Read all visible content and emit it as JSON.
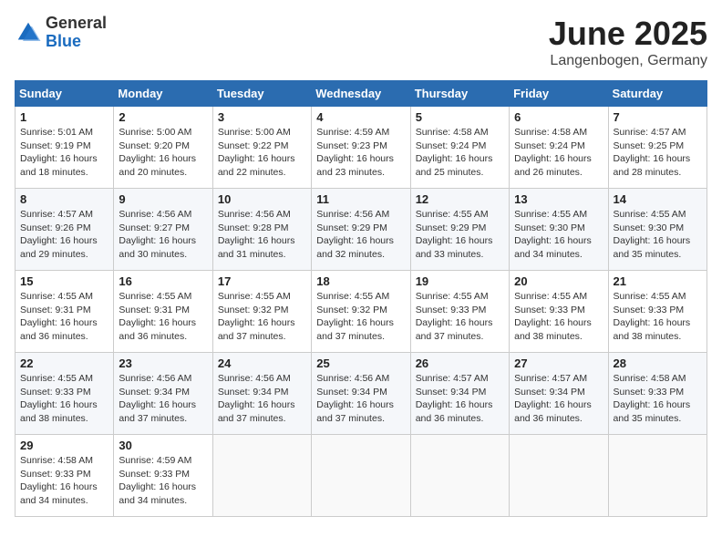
{
  "header": {
    "logo_general": "General",
    "logo_blue": "Blue",
    "title": "June 2025",
    "location": "Langenbogen, Germany"
  },
  "calendar": {
    "days_of_week": [
      "Sunday",
      "Monday",
      "Tuesday",
      "Wednesday",
      "Thursday",
      "Friday",
      "Saturday"
    ],
    "weeks": [
      [
        {
          "day": 1,
          "sunrise": "5:01 AM",
          "sunset": "9:19 PM",
          "daylight": "16 hours and 18 minutes."
        },
        {
          "day": 2,
          "sunrise": "5:00 AM",
          "sunset": "9:20 PM",
          "daylight": "16 hours and 20 minutes."
        },
        {
          "day": 3,
          "sunrise": "5:00 AM",
          "sunset": "9:22 PM",
          "daylight": "16 hours and 22 minutes."
        },
        {
          "day": 4,
          "sunrise": "4:59 AM",
          "sunset": "9:23 PM",
          "daylight": "16 hours and 23 minutes."
        },
        {
          "day": 5,
          "sunrise": "4:58 AM",
          "sunset": "9:24 PM",
          "daylight": "16 hours and 25 minutes."
        },
        {
          "day": 6,
          "sunrise": "4:58 AM",
          "sunset": "9:24 PM",
          "daylight": "16 hours and 26 minutes."
        },
        {
          "day": 7,
          "sunrise": "4:57 AM",
          "sunset": "9:25 PM",
          "daylight": "16 hours and 28 minutes."
        }
      ],
      [
        {
          "day": 8,
          "sunrise": "4:57 AM",
          "sunset": "9:26 PM",
          "daylight": "16 hours and 29 minutes."
        },
        {
          "day": 9,
          "sunrise": "4:56 AM",
          "sunset": "9:27 PM",
          "daylight": "16 hours and 30 minutes."
        },
        {
          "day": 10,
          "sunrise": "4:56 AM",
          "sunset": "9:28 PM",
          "daylight": "16 hours and 31 minutes."
        },
        {
          "day": 11,
          "sunrise": "4:56 AM",
          "sunset": "9:29 PM",
          "daylight": "16 hours and 32 minutes."
        },
        {
          "day": 12,
          "sunrise": "4:55 AM",
          "sunset": "9:29 PM",
          "daylight": "16 hours and 33 minutes."
        },
        {
          "day": 13,
          "sunrise": "4:55 AM",
          "sunset": "9:30 PM",
          "daylight": "16 hours and 34 minutes."
        },
        {
          "day": 14,
          "sunrise": "4:55 AM",
          "sunset": "9:30 PM",
          "daylight": "16 hours and 35 minutes."
        }
      ],
      [
        {
          "day": 15,
          "sunrise": "4:55 AM",
          "sunset": "9:31 PM",
          "daylight": "16 hours and 36 minutes."
        },
        {
          "day": 16,
          "sunrise": "4:55 AM",
          "sunset": "9:31 PM",
          "daylight": "16 hours and 36 minutes."
        },
        {
          "day": 17,
          "sunrise": "4:55 AM",
          "sunset": "9:32 PM",
          "daylight": "16 hours and 37 minutes."
        },
        {
          "day": 18,
          "sunrise": "4:55 AM",
          "sunset": "9:32 PM",
          "daylight": "16 hours and 37 minutes."
        },
        {
          "day": 19,
          "sunrise": "4:55 AM",
          "sunset": "9:33 PM",
          "daylight": "16 hours and 37 minutes."
        },
        {
          "day": 20,
          "sunrise": "4:55 AM",
          "sunset": "9:33 PM",
          "daylight": "16 hours and 38 minutes."
        },
        {
          "day": 21,
          "sunrise": "4:55 AM",
          "sunset": "9:33 PM",
          "daylight": "16 hours and 38 minutes."
        }
      ],
      [
        {
          "day": 22,
          "sunrise": "4:55 AM",
          "sunset": "9:33 PM",
          "daylight": "16 hours and 38 minutes."
        },
        {
          "day": 23,
          "sunrise": "4:56 AM",
          "sunset": "9:34 PM",
          "daylight": "16 hours and 37 minutes."
        },
        {
          "day": 24,
          "sunrise": "4:56 AM",
          "sunset": "9:34 PM",
          "daylight": "16 hours and 37 minutes."
        },
        {
          "day": 25,
          "sunrise": "4:56 AM",
          "sunset": "9:34 PM",
          "daylight": "16 hours and 37 minutes."
        },
        {
          "day": 26,
          "sunrise": "4:57 AM",
          "sunset": "9:34 PM",
          "daylight": "16 hours and 36 minutes."
        },
        {
          "day": 27,
          "sunrise": "4:57 AM",
          "sunset": "9:34 PM",
          "daylight": "16 hours and 36 minutes."
        },
        {
          "day": 28,
          "sunrise": "4:58 AM",
          "sunset": "9:33 PM",
          "daylight": "16 hours and 35 minutes."
        }
      ],
      [
        {
          "day": 29,
          "sunrise": "4:58 AM",
          "sunset": "9:33 PM",
          "daylight": "16 hours and 34 minutes."
        },
        {
          "day": 30,
          "sunrise": "4:59 AM",
          "sunset": "9:33 PM",
          "daylight": "16 hours and 34 minutes."
        },
        null,
        null,
        null,
        null,
        null
      ]
    ]
  }
}
